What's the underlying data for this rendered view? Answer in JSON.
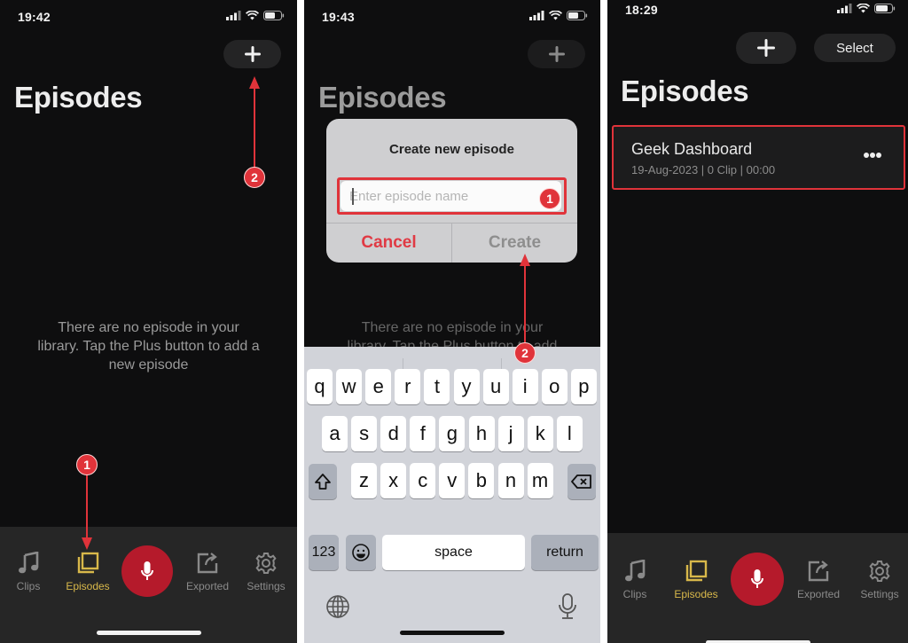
{
  "panels": [
    {
      "status": {
        "time": "19:42"
      },
      "add_button_icon": "plus-icon",
      "title": "Episodes",
      "empty_message": "There are no episode in your library. Tap the Plus button to add a new episode",
      "tabs": [
        {
          "label": "Clips",
          "icon": "music-note-icon",
          "active": false
        },
        {
          "label": "Episodes",
          "icon": "episodes-stack-icon",
          "active": true
        },
        {
          "label": "Exported",
          "icon": "export-icon",
          "active": false
        },
        {
          "label": "Settings",
          "icon": "gear-icon",
          "active": false
        }
      ],
      "annotations": [
        {
          "label": "1",
          "target": "Episodes tab"
        },
        {
          "label": "2",
          "target": "Plus button"
        }
      ]
    },
    {
      "status": {
        "time": "19:43"
      },
      "title": "Episodes",
      "empty_message": "There are no episode in your library. Tap the Plus button to add",
      "dialog": {
        "title": "Create new episode",
        "input_value": "",
        "input_placeholder": "Enter episode name",
        "cancel_label": "Cancel",
        "create_label": "Create"
      },
      "keyboard": {
        "row1": [
          "q",
          "w",
          "e",
          "r",
          "t",
          "y",
          "u",
          "i",
          "o",
          "p"
        ],
        "row2": [
          "a",
          "s",
          "d",
          "f",
          "g",
          "h",
          "j",
          "k",
          "l"
        ],
        "row3": [
          "z",
          "x",
          "c",
          "v",
          "b",
          "n",
          "m"
        ],
        "numbers_label": "123",
        "space_label": "space",
        "return_label": "return"
      },
      "annotations": [
        {
          "label": "1",
          "target": "Episode name input"
        },
        {
          "label": "2",
          "target": "Create button"
        }
      ]
    },
    {
      "status": {
        "time": "18:29"
      },
      "select_label": "Select",
      "title": "Episodes",
      "episodes": [
        {
          "name": "Geek Dashboard",
          "meta": "19-Aug-2023 | 0 Clip | 00:00"
        }
      ],
      "tabs": [
        {
          "label": "Clips",
          "active": false
        },
        {
          "label": "Episodes",
          "active": true
        },
        {
          "label": "Exported",
          "active": false
        },
        {
          "label": "Settings",
          "active": false
        }
      ]
    }
  ],
  "colors": {
    "accent_gold": "#d8b84a",
    "record_red": "#b51a2b",
    "annotation_red": "#e0333a",
    "cancel_red": "#e03a44",
    "background": "#0e0e0f"
  }
}
